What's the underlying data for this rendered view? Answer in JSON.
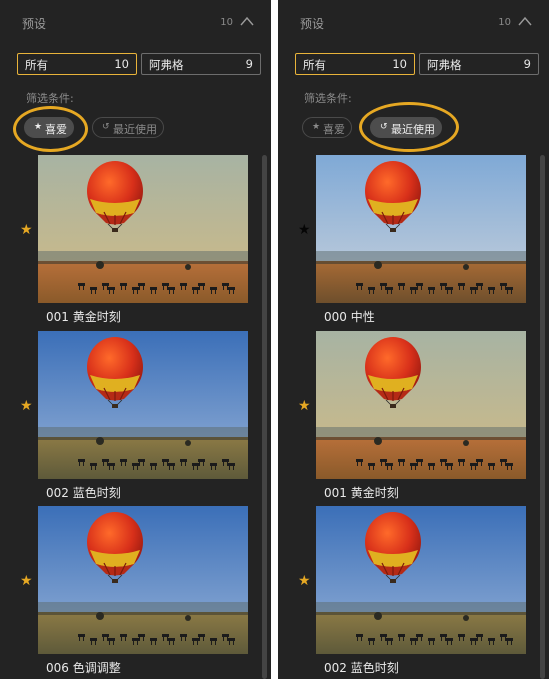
{
  "panels": [
    {
      "header": {
        "title": "预设",
        "count": "10"
      },
      "tabs": [
        {
          "label": "所有",
          "count": "10"
        },
        {
          "label": "阿弗格",
          "count": "9"
        }
      ],
      "filter_label": "筛选条件:",
      "chips": {
        "favorites": "喜爱",
        "recent": "最近使用"
      },
      "presets": [
        {
          "name": "001 黄金时刻",
          "tone": "golden",
          "star": "gold"
        },
        {
          "name": "002 蓝色时刻",
          "tone": "blue",
          "star": "gold"
        },
        {
          "name": "006 色调调整",
          "tone": "blue",
          "star": "gold"
        }
      ]
    },
    {
      "header": {
        "title": "预设",
        "count": "10"
      },
      "tabs": [
        {
          "label": "所有",
          "count": "10"
        },
        {
          "label": "阿弗格",
          "count": "9"
        }
      ],
      "filter_label": "筛选条件:",
      "chips": {
        "favorites": "喜爱",
        "recent": "最近使用"
      },
      "presets": [
        {
          "name": "000 中性",
          "tone": "neutral",
          "star": "black"
        },
        {
          "name": "001 黄金时刻",
          "tone": "golden",
          "star": "gold"
        },
        {
          "name": "002 蓝色时刻",
          "tone": "blue",
          "star": "gold"
        }
      ]
    }
  ],
  "colors": {
    "accent": "#e6a823",
    "panel_bg": "#232323",
    "active_tab_border": "#e8b33a"
  }
}
